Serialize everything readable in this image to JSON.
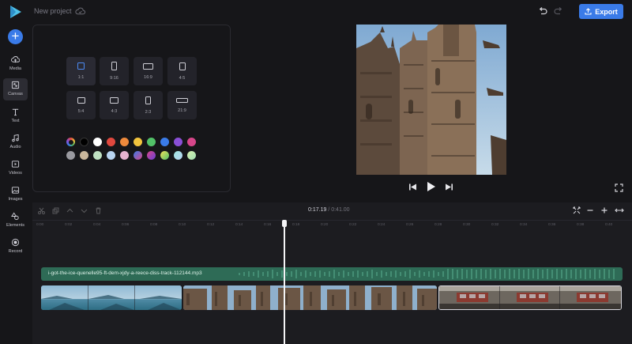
{
  "header": {
    "project_title": "New project",
    "export_label": "Export",
    "brand_color": "#3a7be8"
  },
  "sidebar": {
    "add_label": "+",
    "items": [
      {
        "label": "Media",
        "icon": "cloud-upload-icon"
      },
      {
        "label": "Canvas",
        "icon": "canvas-resize-icon",
        "active": true
      },
      {
        "label": "Text",
        "icon": "text-icon"
      },
      {
        "label": "Audio",
        "icon": "music-note-icon"
      },
      {
        "label": "Videos",
        "icon": "video-icon"
      },
      {
        "label": "Images",
        "icon": "image-icon"
      },
      {
        "label": "Elements",
        "icon": "shapes-icon"
      },
      {
        "label": "Record",
        "icon": "record-icon"
      }
    ]
  },
  "canvas_panel": {
    "ratios": [
      {
        "label": "1:1",
        "selected": true
      },
      {
        "label": "9:16"
      },
      {
        "label": "16:9"
      },
      {
        "label": "4:5"
      },
      {
        "label": "5:4"
      },
      {
        "label": "4:3"
      },
      {
        "label": "2:3"
      },
      {
        "label": "21:9"
      }
    ],
    "colors_row1": [
      "rainbow",
      "#000000",
      "#ffffff",
      "#e0483e",
      "#ef8a3c",
      "#f2c43d",
      "#52c168",
      "#3a7be8",
      "#8a4fd6",
      "#d6468a"
    ],
    "colors_row2": [
      "#9a9aa0",
      "#c9b79c",
      "#bfe1c2",
      "#b9d5f2",
      "#e6b3cf",
      "gradient-blue-purple",
      "gradient-pink-purple",
      "gradient-yellow-green",
      "gradient-teal",
      "gradient-light-green"
    ]
  },
  "timeline": {
    "current_time": "0:17.19",
    "separator": "/",
    "total_time": "0:41.00",
    "ruler_ticks": [
      "0:00",
      "0:02",
      "0:04",
      "0:06",
      "0:08",
      "0:10",
      "0:12",
      "0:14",
      "0:16",
      "0:18",
      "0:20",
      "0:22",
      "0:24",
      "0:26",
      "0:28",
      "0:30",
      "0:32",
      "0:34",
      "0:36",
      "0:38",
      "0:40"
    ],
    "audio_clip_name": "i-got-the-ice-quenelle95-ft-dem-xjdy-a-reece-diss-track-112144.mp3"
  }
}
